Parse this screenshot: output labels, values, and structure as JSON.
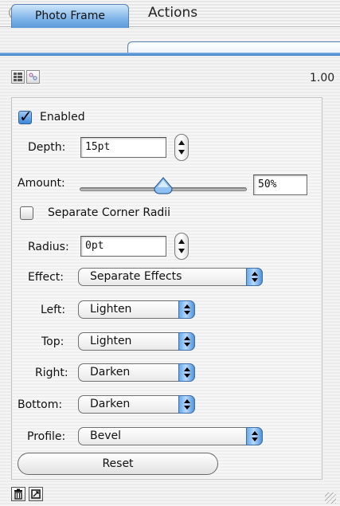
{
  "window": {
    "title": "Actions"
  },
  "tabs": [
    {
      "label": "Photo Frame",
      "selected": true
    }
  ],
  "toolbar": {
    "zoom_text": "1.00"
  },
  "enabled": {
    "label": "Enabled",
    "checked": true
  },
  "depth": {
    "label": "Depth:",
    "value": "15pt"
  },
  "amount": {
    "label": "Amount:",
    "value": "50%",
    "slider_fraction": 0.5
  },
  "corner_radii": {
    "label": "Separate Corner Radii",
    "checked": false
  },
  "radius": {
    "label": "Radius:",
    "value": "0pt"
  },
  "effect": {
    "label": "Effect:",
    "value": "Separate Effects"
  },
  "left": {
    "label": "Left:",
    "value": "Lighten"
  },
  "top": {
    "label": "Top:",
    "value": "Lighten"
  },
  "right": {
    "label": "Right:",
    "value": "Darken"
  },
  "bottom": {
    "label": "Bottom:",
    "value": "Darken"
  },
  "profile": {
    "label": "Profile:",
    "value": "Bevel"
  },
  "reset_label": "Reset",
  "icons": {
    "toolbar": [
      "list-view-icon",
      "options-icon"
    ],
    "bottom": [
      "trash-icon",
      "new-item-icon"
    ]
  },
  "colors": {
    "accent": "#5d9ad9",
    "tab_border": "#5a7fb0"
  }
}
